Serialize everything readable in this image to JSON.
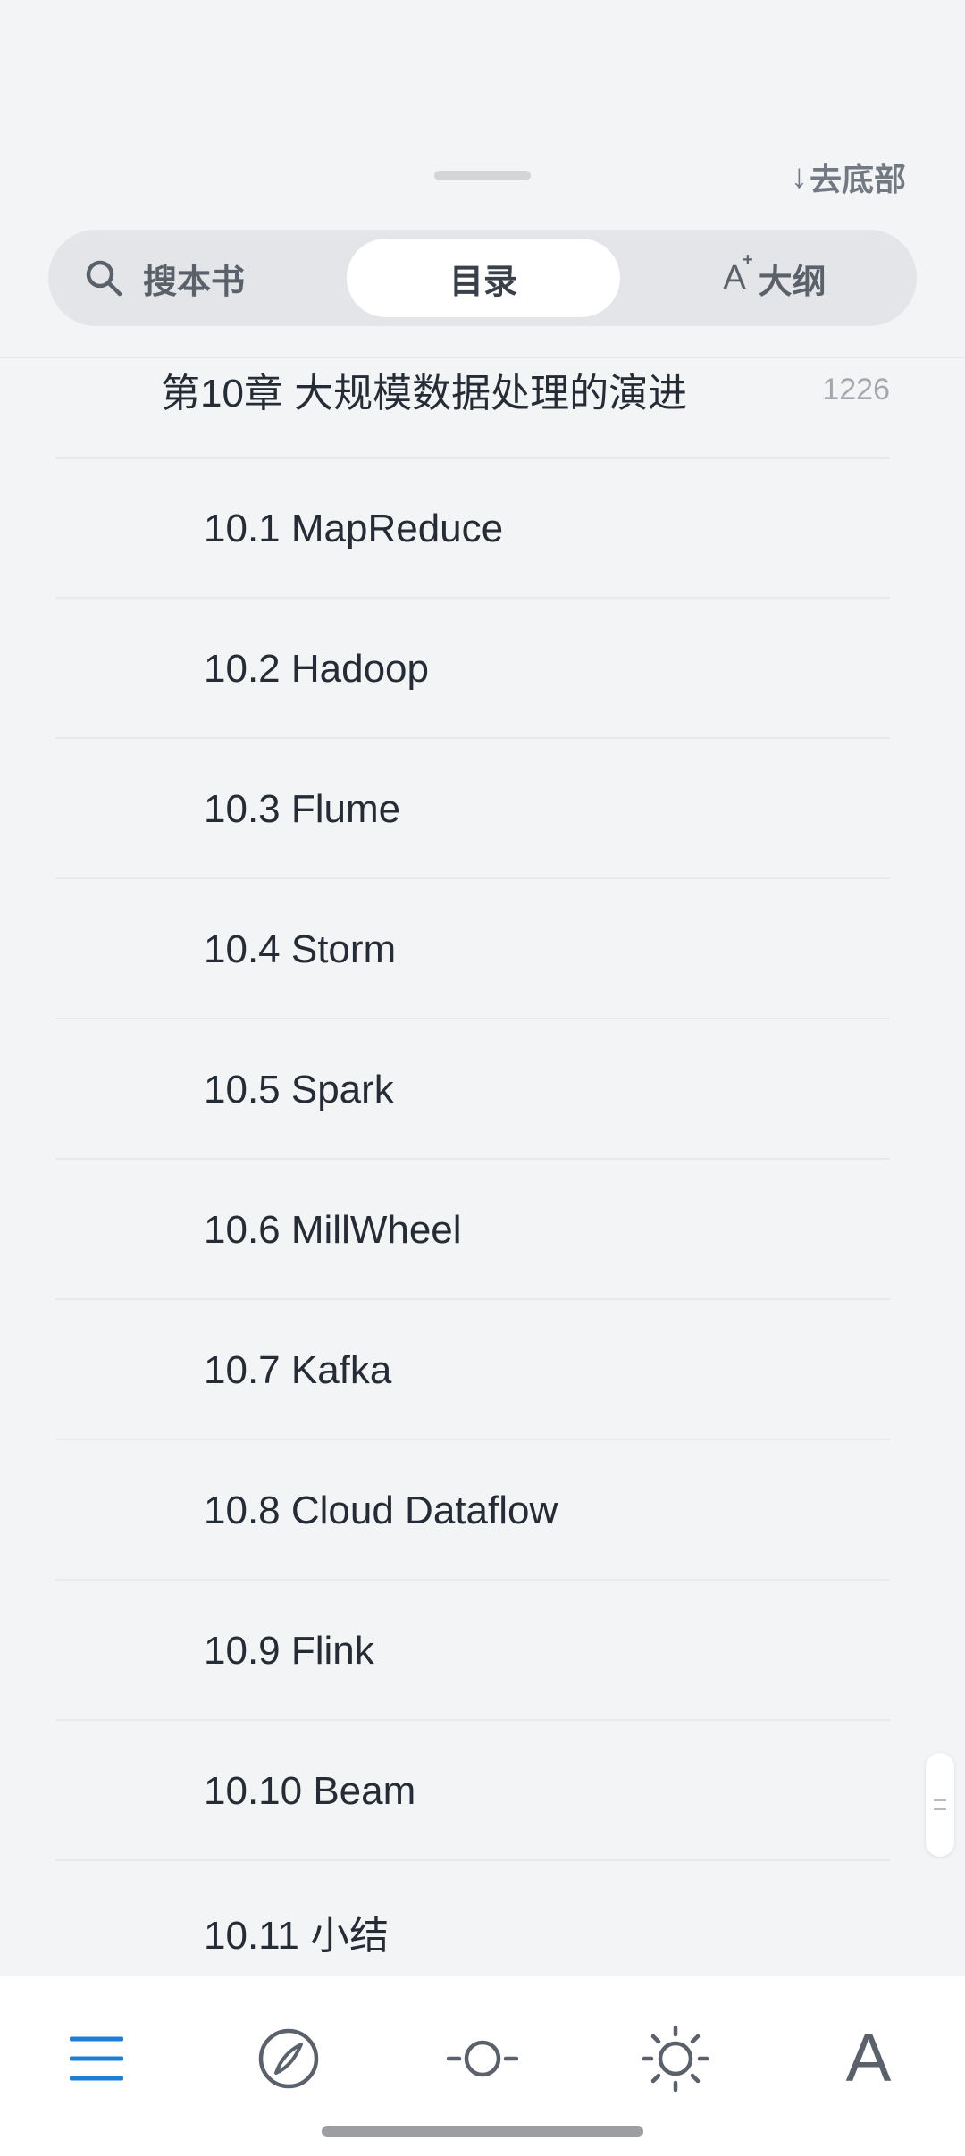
{
  "header": {
    "go_bottom_label": "去底部",
    "go_bottom_arrow": "↓"
  },
  "tabs": {
    "search_label": "搜本书",
    "toc_label": "目录",
    "outline_label": "大纲",
    "outline_mark": "A",
    "outline_sup": "+",
    "active": "目录"
  },
  "toc": {
    "chapter": {
      "label": "第10章 大规模数据处理的演进",
      "page": "1226"
    },
    "sections": [
      {
        "label": "10.1 MapReduce"
      },
      {
        "label": "10.2 Hadoop"
      },
      {
        "label": "10.3 Flume"
      },
      {
        "label": "10.4 Storm"
      },
      {
        "label": "10.5 Spark"
      },
      {
        "label": "10.6 MillWheel"
      },
      {
        "label": "10.7 Kafka"
      },
      {
        "label": "10.8 Cloud Dataflow"
      },
      {
        "label": "10.9 Flink"
      },
      {
        "label": "10.10 Beam"
      },
      {
        "label": "10.11 小结"
      }
    ]
  },
  "toolbar": {
    "font_label": "A",
    "items": [
      "menu-icon",
      "compass-icon",
      "progress-icon",
      "brightness-icon",
      "font-icon"
    ],
    "active_color": "#1a7fd6"
  }
}
